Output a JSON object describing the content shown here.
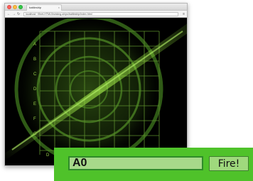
{
  "browser": {
    "tab_title": "battleship",
    "tab_close_icon": "close-icon",
    "url": "localhost:~/fleet-HTML5/sinking-ships/battleship/index.html",
    "nav_icons": [
      "back-arrow-icon",
      "forward-arrow-icon",
      "reload-icon",
      "menu-icon"
    ]
  },
  "radar": {
    "row_labels": [
      "A",
      "B",
      "C",
      "D",
      "E",
      "F",
      "G"
    ],
    "col_labels": [
      "D"
    ],
    "colors": {
      "background": "#000000",
      "grid": "#5d8f2c",
      "rings": "#3f6e1d",
      "sweep": "#8fe13a",
      "label": "#9ad04a"
    }
  },
  "fire_panel": {
    "coordinate_value": "A0",
    "fire_label": "Fire!",
    "colors": {
      "panel": "#4fc22a",
      "input_bg": "#a7d98a",
      "button_bg": "#9fd97d"
    }
  }
}
